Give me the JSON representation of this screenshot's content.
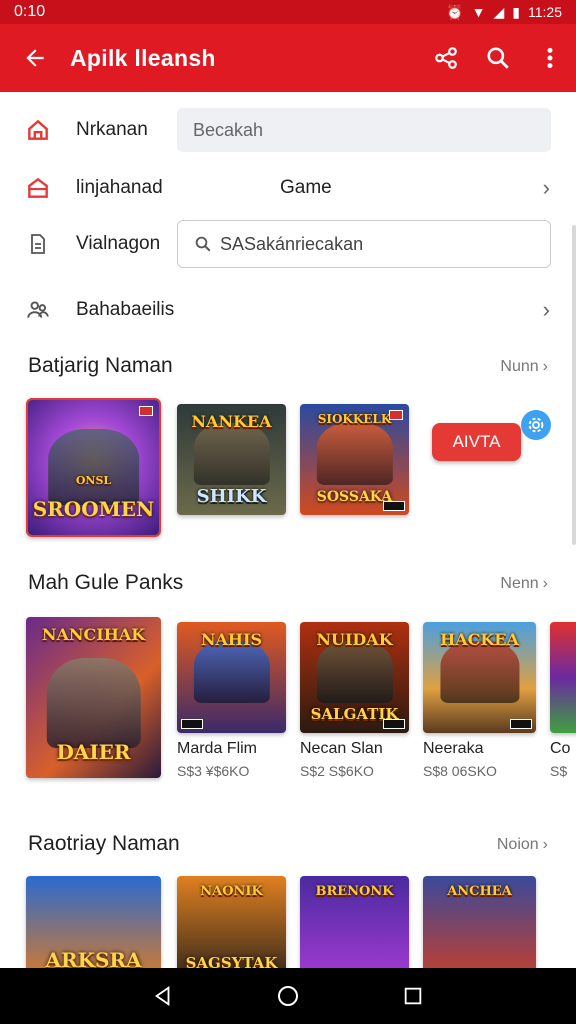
{
  "status_bar": {
    "time": "0:10",
    "clock_right": "11:25"
  },
  "app_bar": {
    "title": "Apilk lleansh"
  },
  "settings": [
    {
      "label": "Nrkanan",
      "field_placeholder": "Becakah"
    },
    {
      "label": "linjahanad",
      "value": "Game"
    },
    {
      "label": "Vialnagon",
      "search_placeholder": "SASakánriecakan"
    },
    {
      "label": "Bahabaeilis"
    }
  ],
  "sections": [
    {
      "title": "Batjarig Naman",
      "more": "Nunn"
    },
    {
      "title": "Mah Gule Panks",
      "more": "Nenn"
    },
    {
      "title": "Raotriay Naman",
      "more": "Noion"
    }
  ],
  "featured_row": {
    "cards": [
      {
        "top": "ONSL",
        "label": "SROOMEN"
      },
      {
        "top": "NANKEA",
        "label": "SHIKK"
      },
      {
        "top": "SIOKKELK",
        "label": "SOSSAKA"
      }
    ],
    "pill_label": "AIVTA"
  },
  "games_row": [
    {
      "top": "NANCIHAK",
      "label": "DAIER",
      "name": "",
      "price": ""
    },
    {
      "top": "NAHIS",
      "label": "",
      "name": "Marda Flim",
      "price": "S$3 ¥$6KO"
    },
    {
      "top": "NUIDAK",
      "label": "SALGATIK",
      "name": "Necan Slan",
      "price": "S$2 S$6KO"
    },
    {
      "top": "HACKEA",
      "label": "",
      "name": "Neeraka",
      "price": "S$8 06SKO"
    },
    {
      "top": "",
      "label": "",
      "name": "Co",
      "price": "S$"
    }
  ],
  "bottom_row": [
    {
      "top": "",
      "label": "ARKSRA"
    },
    {
      "top": "NAONIK",
      "label": "SAGSYTAK"
    },
    {
      "top": "BRENONK",
      "label": ""
    },
    {
      "top": "ANCHEA",
      "label": ""
    }
  ],
  "colors": {
    "accent": "#e01a22",
    "status": "#c8101a",
    "fab": "#3fa2f0"
  }
}
